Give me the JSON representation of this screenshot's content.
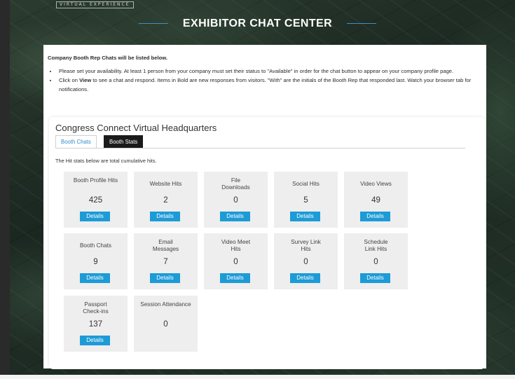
{
  "branding": {
    "logo_text": "VIRTUAL EXPERIENCE"
  },
  "header": {
    "title": "EXHIBITOR CHAT CENTER"
  },
  "intro": {
    "heading": "Company Booth Rep Chats will be listed below.",
    "bullet1": "Please set your availability. At least 1 person from your company must set their status to \"Available\" in order for the chat button to appear on your company profile page.",
    "bullet2_pre": "Click on ",
    "bullet2_bold": "View",
    "bullet2_post": " to see a chat and respond. Items in Bold are new responses from visitors. \"With\" are the initials of the Booth Rep that responded last. Watch your browser tab for notifications."
  },
  "card": {
    "title": "Congress Connect Virtual Headquarters",
    "tabs": [
      {
        "label": "Booth Chats",
        "active": false
      },
      {
        "label": "Booth Stats",
        "active": true
      }
    ],
    "note": "The Hit stats below are total cumulative hits."
  },
  "stats": [
    {
      "label": "Booth Profile Hits",
      "value": "425",
      "button": "Details"
    },
    {
      "label": "Website Hits",
      "value": "2",
      "button": "Details"
    },
    {
      "label": "File Downloads",
      "value": "0",
      "button": "Details"
    },
    {
      "label": "Social Hits",
      "value": "5",
      "button": "Details"
    },
    {
      "label": "Video Views",
      "value": "49",
      "button": "Details"
    },
    {
      "label": "Booth Chats",
      "value": "9",
      "button": "Details"
    },
    {
      "label": "Email Messages",
      "value": "7",
      "button": "Details"
    },
    {
      "label": "Video Meet Hits",
      "value": "0",
      "button": "Details"
    },
    {
      "label": "Survey Link Hits",
      "value": "0",
      "button": "Details"
    },
    {
      "label": "Schedule Link Hits",
      "value": "0",
      "button": "Details"
    },
    {
      "label": "Passport Check-ins",
      "value": "137",
      "button": "Details"
    },
    {
      "label": "Session Attendance",
      "value": "0",
      "button": ""
    }
  ],
  "colors": {
    "accent": "#1d9bd7",
    "tab_active_bg": "#1a1a1a",
    "stat_bg": "#eeeeee"
  }
}
